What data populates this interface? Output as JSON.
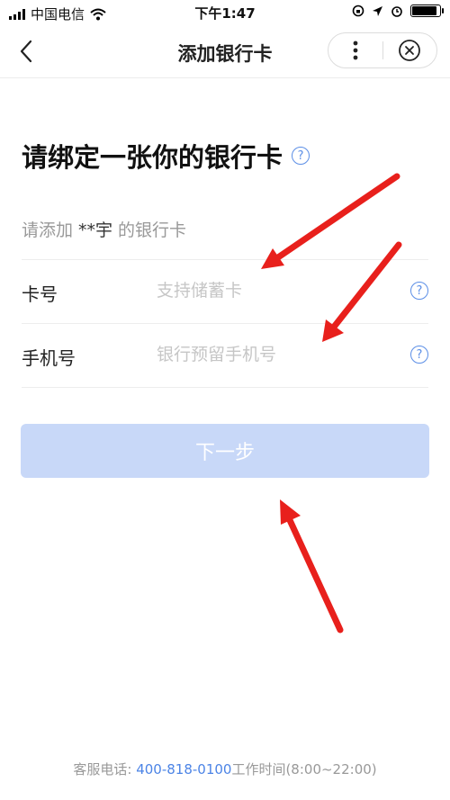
{
  "status_bar": {
    "carrier": "中国电信",
    "time": "下午1:47",
    "battery_level": 0.9,
    "icons": [
      "signal-icon",
      "wifi-icon",
      "orientation-lock-icon",
      "location-icon",
      "alarm-icon",
      "battery-icon"
    ]
  },
  "nav": {
    "title": "添加银行卡",
    "back_icon": "chevron-left-icon",
    "more_icon": "more-vertical-icon",
    "close_icon": "close-circle-icon"
  },
  "main": {
    "heading": "请绑定一张你的银行卡",
    "subtitle_prefix": "请添加",
    "subtitle_name": "**宇",
    "subtitle_suffix": "的银行卡",
    "fields": [
      {
        "label": "卡号",
        "placeholder": "支持储蓄卡",
        "value": ""
      },
      {
        "label": "手机号",
        "placeholder": "银行预留手机号",
        "value": ""
      }
    ],
    "help_glyph": "?",
    "next_button": "下一步"
  },
  "footer": {
    "label": "客服电话: ",
    "phone": "400-818-0100",
    "hours": "工作时间(8:00~22:00)"
  },
  "colors": {
    "accent": "#4c84e6",
    "button_disabled": "#c8d8f8",
    "annotation_arrow": "#e8201c"
  }
}
